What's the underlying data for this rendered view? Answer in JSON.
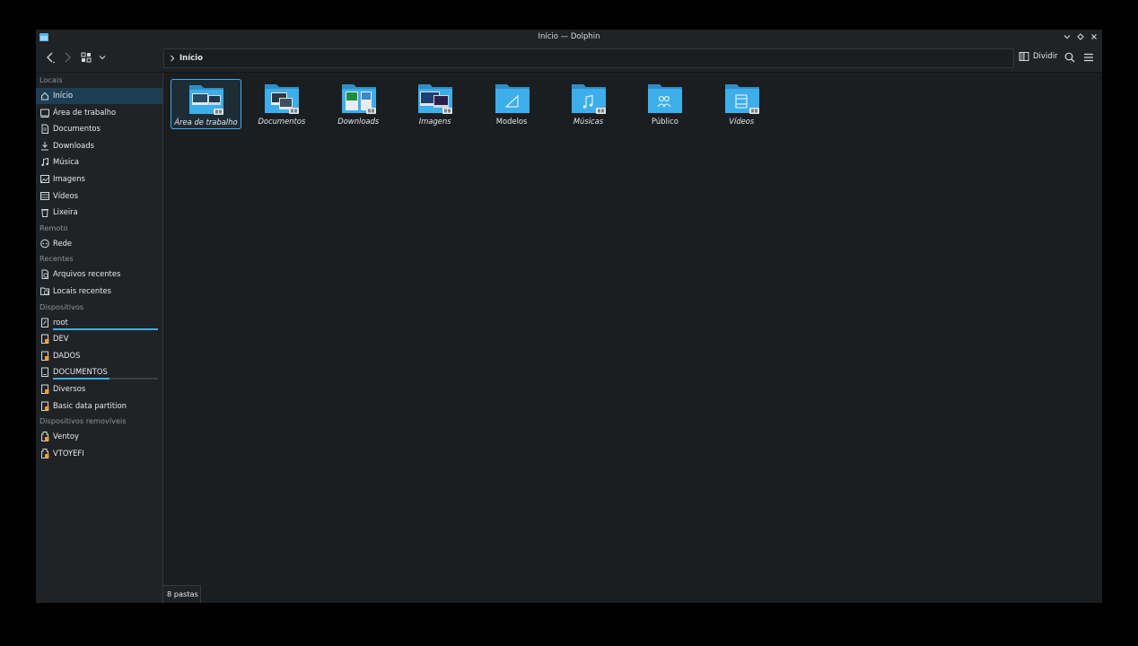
{
  "window": {
    "title": "Início — Dolphin"
  },
  "toolbar": {
    "location": "Início",
    "split_label": "Dividir"
  },
  "sidebar": {
    "sections": [
      {
        "title": "Locais",
        "items": [
          {
            "label": "Início",
            "icon": "home-icon",
            "active": true
          },
          {
            "label": "Área de trabalho",
            "icon": "desktop-icon"
          },
          {
            "label": "Documentos",
            "icon": "documents-icon"
          },
          {
            "label": "Downloads",
            "icon": "download-icon"
          },
          {
            "label": "Música",
            "icon": "music-icon"
          },
          {
            "label": "Imagens",
            "icon": "pictures-icon"
          },
          {
            "label": "Vídeos",
            "icon": "videos-icon"
          },
          {
            "label": "Lixeira",
            "icon": "trash-icon"
          }
        ]
      },
      {
        "title": "Remoto",
        "items": [
          {
            "label": "Rede",
            "icon": "network-icon"
          }
        ]
      },
      {
        "title": "Recentes",
        "items": [
          {
            "label": "Arquivos recentes",
            "icon": "recent-files-icon"
          },
          {
            "label": "Locais recentes",
            "icon": "recent-locations-icon"
          }
        ]
      },
      {
        "title": "Dispositivos",
        "items": [
          {
            "label": "root",
            "icon": "drive-root-icon",
            "capacity": 1.0
          },
          {
            "label": "DEV",
            "icon": "drive-icon"
          },
          {
            "label": "DADOS",
            "icon": "drive-icon"
          },
          {
            "label": "DOCUMENTOS",
            "icon": "drive-harddisk-icon",
            "capacity": 0.54
          },
          {
            "label": "Diversos",
            "icon": "drive-icon"
          },
          {
            "label": "Basic data partition",
            "icon": "drive-icon"
          }
        ]
      },
      {
        "title": "Dispositivos removíveis",
        "items": [
          {
            "label": "Ventoy",
            "icon": "usb-drive-icon"
          },
          {
            "label": "VTOYEFI",
            "icon": "usb-drive-icon"
          }
        ]
      }
    ]
  },
  "folders": [
    {
      "name": "Área de trabalho",
      "italic": true,
      "selected": true,
      "icon": "folder-desktop-icon"
    },
    {
      "name": "Documentos",
      "italic": true,
      "icon": "folder-documents-icon"
    },
    {
      "name": "Downloads",
      "italic": true,
      "icon": "folder-downloads-icon"
    },
    {
      "name": "Imagens",
      "italic": true,
      "icon": "folder-pictures-icon"
    },
    {
      "name": "Modelos",
      "italic": false,
      "icon": "folder-templates-icon"
    },
    {
      "name": "Músicas",
      "italic": true,
      "icon": "folder-music-icon"
    },
    {
      "name": "Público",
      "italic": false,
      "icon": "folder-public-icon"
    },
    {
      "name": "Vídeos",
      "italic": true,
      "icon": "folder-videos-icon"
    }
  ],
  "status": {
    "text": "8 pastas"
  },
  "colors": {
    "accent": "#3daee9",
    "folder": "#3daee9",
    "window_bg": "#1b1e21",
    "panel_bg": "#202326"
  }
}
